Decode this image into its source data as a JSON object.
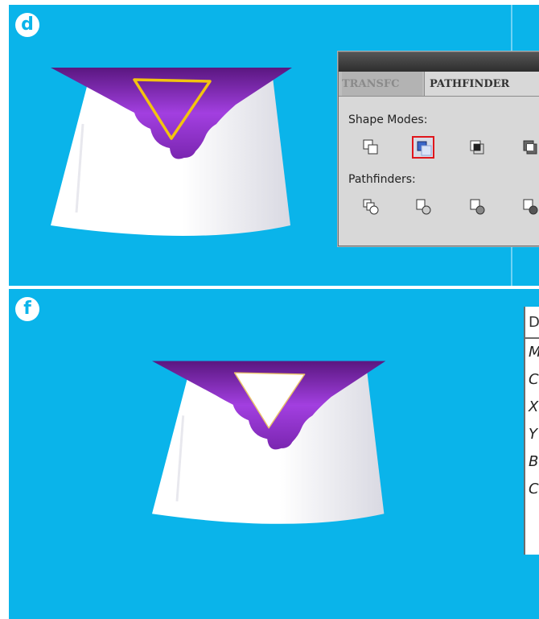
{
  "steps": {
    "d": "d",
    "f": "f"
  },
  "colors": {
    "background": "#0ab4ea",
    "purple_dark": "#5a1780",
    "purple_light": "#a23fe0",
    "outline_yellow": "#f3c40f",
    "selected_border": "#e0161c"
  },
  "pathfinder_panel": {
    "tab_transform": "TRANSFC",
    "tab_pathfinder": "PATHFINDER",
    "shape_modes_label": "Shape Modes:",
    "pathfinders_label": "Pathfinders:",
    "selected_shape_mode": "minus-front",
    "shape_mode_icons": [
      "unite-icon",
      "minus-front-icon",
      "intersect-icon",
      "exclude-icon"
    ],
    "pathfinder_icons": [
      "divide-icon",
      "trim-icon",
      "merge-icon",
      "crop-icon"
    ]
  },
  "info_panel": {
    "header": "D",
    "rows": [
      "M",
      "C",
      "X",
      "Y",
      "B",
      "C"
    ]
  }
}
